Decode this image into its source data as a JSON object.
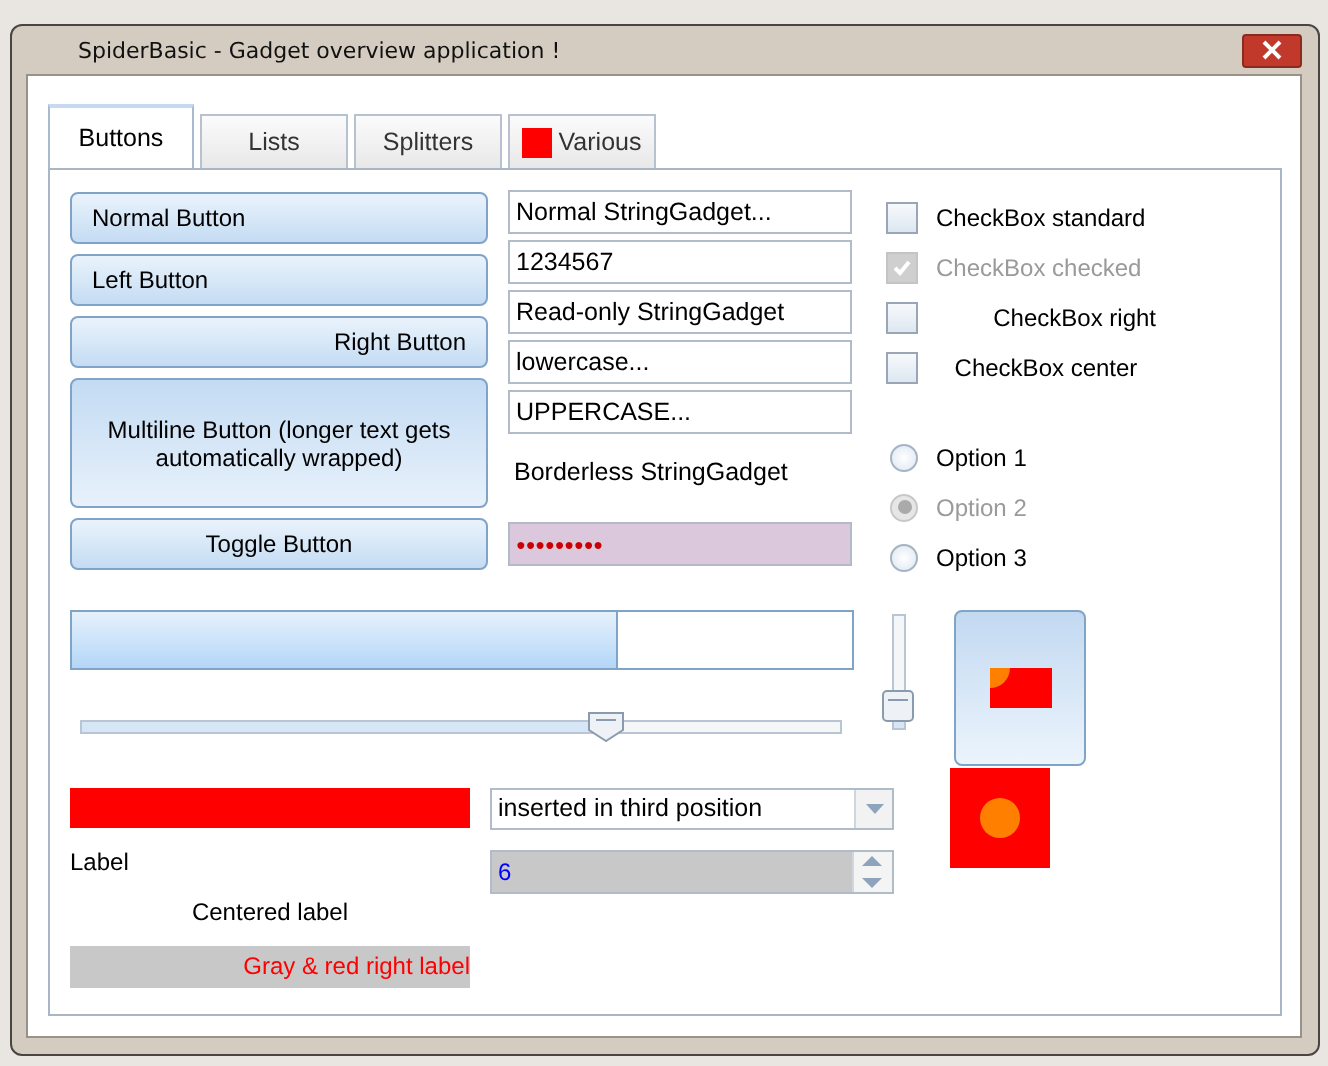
{
  "window": {
    "title": "SpiderBasic - Gadget overview application !"
  },
  "tabs": [
    {
      "label": "Buttons",
      "selected": true,
      "icon": false
    },
    {
      "label": "Lists",
      "selected": false,
      "icon": false
    },
    {
      "label": "Splitters",
      "selected": false,
      "icon": false
    },
    {
      "label": "Various",
      "selected": false,
      "icon": true
    }
  ],
  "buttons": [
    {
      "label": "Normal Button",
      "kind": "left"
    },
    {
      "label": "Left Button",
      "kind": "left"
    },
    {
      "label": "Right Button",
      "kind": "right"
    },
    {
      "label": "Multiline Button (longer text gets automatically wrapped)",
      "kind": "multiline"
    },
    {
      "label": "Toggle Button",
      "kind": "toggle",
      "pressed": false
    }
  ],
  "string_fields": [
    {
      "value": "Normal StringGadget...",
      "kind": "field"
    },
    {
      "value": "1234567",
      "kind": "field"
    },
    {
      "value": "Read-only StringGadget",
      "kind": "field"
    },
    {
      "value": "lowercase...",
      "kind": "field"
    },
    {
      "value": "UPPERCASE...",
      "kind": "field"
    },
    {
      "value": "Borderless StringGadget",
      "kind": "borderless"
    },
    {
      "value": "●●●●●●●●●",
      "kind": "password"
    }
  ],
  "checkboxes": [
    {
      "label": "CheckBox standard",
      "checked": false,
      "disabled": false,
      "kind": "left"
    },
    {
      "label": "CheckBox checked",
      "checked": true,
      "disabled": true,
      "kind": "left"
    },
    {
      "label": "CheckBox right",
      "checked": false,
      "disabled": false,
      "kind": "right"
    },
    {
      "label": "CheckBox center",
      "checked": false,
      "disabled": false,
      "kind": "center"
    }
  ],
  "options": [
    {
      "label": "Option 1",
      "selected": false,
      "disabled": false
    },
    {
      "label": "Option 2",
      "selected": true,
      "disabled": true
    },
    {
      "label": "Option 3",
      "selected": false,
      "disabled": false
    }
  ],
  "progress": {
    "level": 0.7
  },
  "track_bar": {
    "level": 0.69
  },
  "vertical_track_bar": {
    "level": 0.2
  },
  "combo": {
    "value": "inserted in third position"
  },
  "spin": {
    "value": "6"
  },
  "labels": [
    {
      "text": "Label",
      "kind": "left"
    },
    {
      "text": "Centered label",
      "kind": "center"
    },
    {
      "text": "Gray & red right label",
      "kind": "gray-right"
    }
  ]
}
